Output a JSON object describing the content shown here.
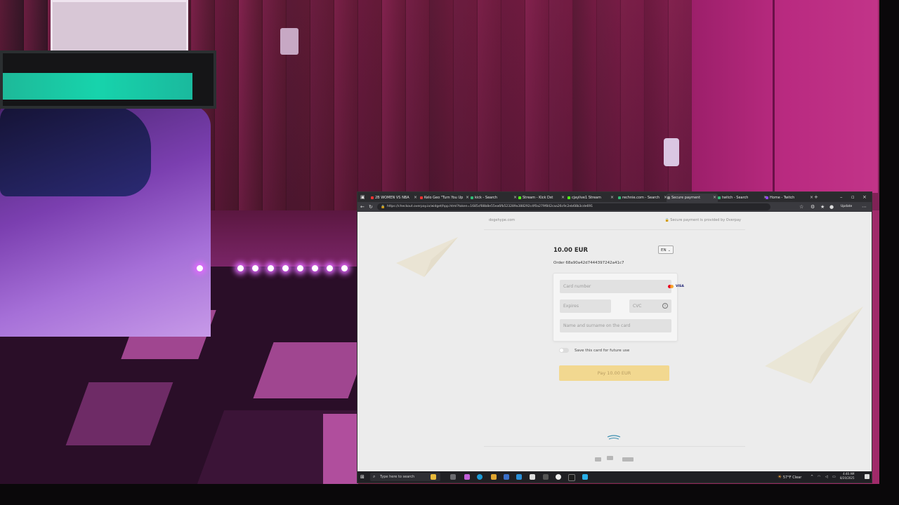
{
  "browser": {
    "tabs": [
      {
        "label": "2B WOMEN VS NBA",
        "fav": "#e33"
      },
      {
        "label": "Kelo Geo \"Turn You Up",
        "fav": "#e33"
      },
      {
        "label": "kick - Search",
        "fav": "#3b7"
      },
      {
        "label": "Stream - Kick Dst",
        "fav": "#53fc18"
      },
      {
        "label": "cjaylive1 Stream",
        "fav": "#53fc18"
      },
      {
        "label": "rechnie.com - Search",
        "fav": "#3b7"
      },
      {
        "label": "Secure payment",
        "fav": "#9a9a9a"
      },
      {
        "label": "twitch - Search",
        "fav": "#3b7"
      },
      {
        "label": "Home - Twitch",
        "fav": "#9146ff"
      }
    ],
    "url": "https://checkout.overpay.io/widget/hpp.html?token=1685cf88b8e55ea6fb523289a388292c4f0a279f842caa26c9c2eb68b3cde691",
    "update_label": "Update"
  },
  "page": {
    "site": "dogehype.com",
    "secure_text": "Secure payment is provided by Overpay",
    "amount": "10.00 EUR",
    "lang": "EN",
    "order": "Order 68a90a42d7444397242a41c7",
    "card_number_placeholder": "Card number",
    "expires_placeholder": "Expires",
    "cvc_placeholder": "CVC",
    "name_placeholder": "Name and surname on the card",
    "visa": "VISA",
    "save_label": "Save this card for future use",
    "pay_label": "Pay 10.00 EUR"
  },
  "taskbar": {
    "search_placeholder": "Type here to search",
    "weather": "57°F  Clear",
    "time": "4:40 AM",
    "date": "8/20/2025"
  },
  "colors": {
    "accent": "#f2d890",
    "page_bg": "#ececec",
    "field_bg": "#e1e1e1"
  }
}
